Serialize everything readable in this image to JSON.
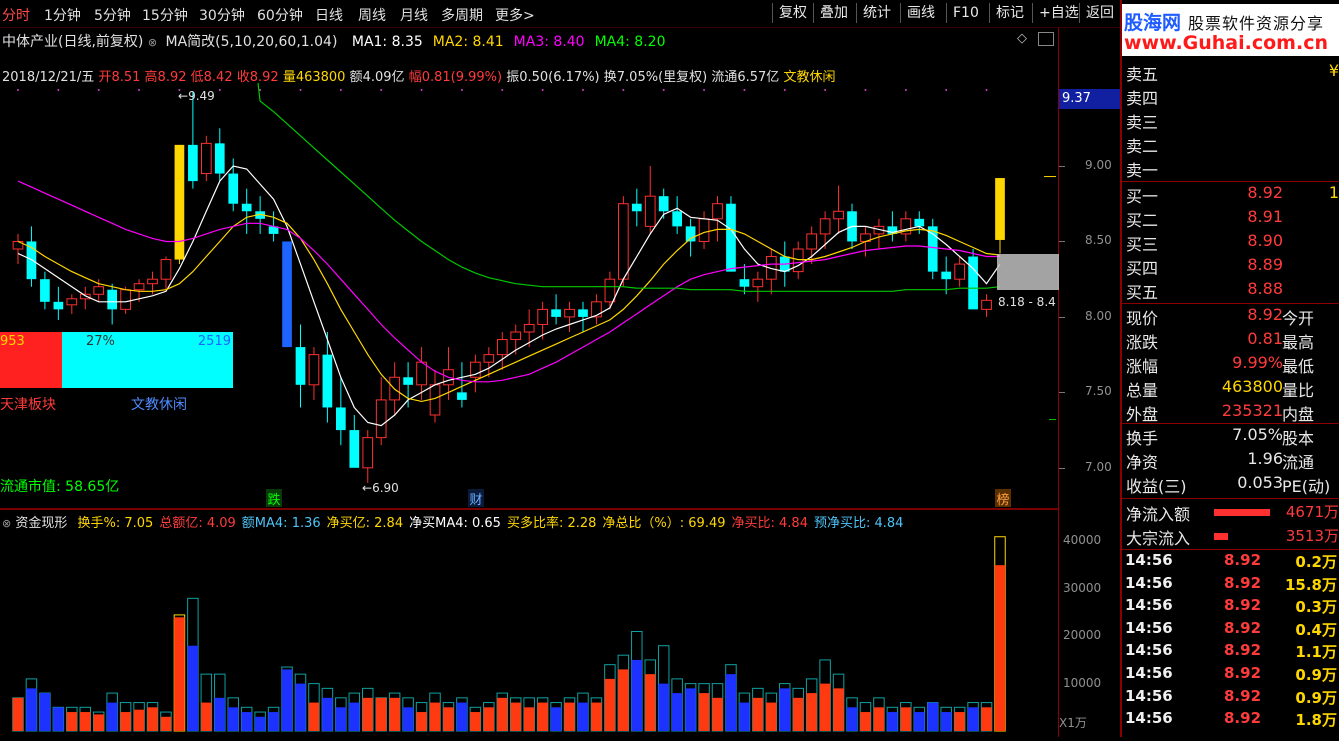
{
  "menu": {
    "periods": [
      "分时",
      "1分钟",
      "5分钟",
      "15分钟",
      "30分钟",
      "60分钟",
      "日线",
      "周线",
      "月线",
      "多周期",
      "更多>"
    ],
    "tools": [
      "复权",
      "叠加",
      "统计",
      "画线",
      "F10",
      "标记",
      "+自选",
      "返回"
    ]
  },
  "watermark": {
    "site": "股海网",
    "slogan": "股票软件资源分享",
    "url": "www.Guhai.com.cn"
  },
  "chart_header": {
    "stock": "中体产业(日线,前复权)",
    "indicator": "MA简改(5,10,20,60,1.04)",
    "ma": [
      {
        "label": "MA1: 8.35",
        "color": "#ffffff"
      },
      {
        "label": "MA2: 8.41",
        "color": "#ffd700"
      },
      {
        "label": "MA3: 8.40",
        "color": "#ff00ff"
      },
      {
        "label": "MA4: 8.20",
        "color": "#00ff00"
      }
    ]
  },
  "info_line": {
    "date": "2018/12/21/五",
    "open": "开8.51",
    "high": "高8.92",
    "low": "低8.42",
    "close": "收8.92",
    "volume": "量463800",
    "amount": "额4.09亿",
    "change": "幅0.81(9.99%)",
    "amplitude": "振0.50(6.17%)",
    "turnover": "换7.05%(里复权)",
    "float": "流通6.57亿",
    "sector": "文教休闲"
  },
  "price_axis": [
    "9.37",
    "9.00",
    "8.50",
    "8.00",
    "7.50",
    "7.00"
  ],
  "current_price_tag": "9.37",
  "annotations": {
    "high_mark": "9.49",
    "low_mark": "6.90",
    "range_label": "8.18 - 8.4",
    "fall_tag": "跌",
    "cai_tag": "财",
    "bang_tag": "榜"
  },
  "overlay": {
    "red_value": "953",
    "pct": "27%",
    "cyan_value": "2519",
    "left_label": "天津板块",
    "right_label": "文教休闲",
    "float_cap": "流通市值: 58.65亿"
  },
  "vol_header": {
    "name": "资金现形",
    "items": [
      {
        "label": "换手%: 7.05",
        "color": "#ffd700"
      },
      {
        "label": "总额亿: 4.09",
        "color": "#ff3b3b"
      },
      {
        "label": "额MA4: 1.36",
        "color": "#4fc3f7"
      },
      {
        "label": "净买亿: 2.84",
        "color": "#ffd700"
      },
      {
        "label": "净买MA4: 0.65",
        "color": "#ffffff"
      },
      {
        "label": "买多比率: 2.28",
        "color": "#ffd700"
      },
      {
        "label": "净总比（%）: 69.49",
        "color": "#ffd700"
      },
      {
        "label": "净买比: 4.84",
        "color": "#ff3b3b"
      },
      {
        "label": "预净买比: 4.84",
        "color": "#4fc3f7"
      }
    ]
  },
  "vol_axis": [
    "40000",
    "30000",
    "20000",
    "10000"
  ],
  "vol_unit": "X1万",
  "order_book": {
    "asks": [
      {
        "label": "卖五",
        "price": "",
        "vol": "¥"
      },
      {
        "label": "卖四",
        "price": "",
        "vol": ""
      },
      {
        "label": "卖三",
        "price": "",
        "vol": ""
      },
      {
        "label": "卖二",
        "price": "",
        "vol": ""
      },
      {
        "label": "卖一",
        "price": "",
        "vol": ""
      }
    ],
    "bids": [
      {
        "label": "买一",
        "price": "8.92",
        "vol": "1"
      },
      {
        "label": "买二",
        "price": "8.91",
        "vol": ""
      },
      {
        "label": "买三",
        "price": "8.90",
        "vol": ""
      },
      {
        "label": "买四",
        "price": "8.89",
        "vol": ""
      },
      {
        "label": "买五",
        "price": "8.88",
        "vol": ""
      }
    ]
  },
  "stats": [
    {
      "k": "现价",
      "v": "8.92",
      "k2": "今开"
    },
    {
      "k": "涨跌",
      "v": "0.81",
      "k2": "最高"
    },
    {
      "k": "涨幅",
      "v": "9.99%",
      "k2": "最低"
    },
    {
      "k": "总量",
      "v": "463800",
      "k2": "量比",
      "vcolor": "#ffd700"
    },
    {
      "k": "外盘",
      "v": "235321",
      "k2": "内盘"
    }
  ],
  "stats2": [
    {
      "k": "换手",
      "v": "7.05%",
      "k2": "股本"
    },
    {
      "k": "净资",
      "v": "1.96",
      "k2": "流通"
    },
    {
      "k": "收益(三)",
      "v": "0.053",
      "k2": "PE(动)"
    }
  ],
  "flow": [
    {
      "k": "净流入额",
      "v": "4671万"
    },
    {
      "k": "大宗流入",
      "v": "3513万"
    }
  ],
  "ticks": [
    {
      "t": "14:56",
      "p": "8.92",
      "a": "0.2万"
    },
    {
      "t": "14:56",
      "p": "8.92",
      "a": "15.8万"
    },
    {
      "t": "14:56",
      "p": "8.92",
      "a": "0.3万"
    },
    {
      "t": "14:56",
      "p": "8.92",
      "a": "0.4万"
    },
    {
      "t": "14:56",
      "p": "8.92",
      "a": "1.1万"
    },
    {
      "t": "14:56",
      "p": "8.92",
      "a": "0.9万"
    },
    {
      "t": "14:56",
      "p": "8.92",
      "a": "0.9万"
    },
    {
      "t": "14:56",
      "p": "8.92",
      "a": "1.8万"
    }
  ],
  "chart_data": {
    "type": "candlestick",
    "price_range": [
      6.8,
      9.55
    ],
    "candles": [
      [
        8.45,
        8.55,
        8.35,
        8.5
      ],
      [
        8.5,
        8.6,
        8.2,
        8.25
      ],
      [
        8.25,
        8.3,
        8.05,
        8.1
      ],
      [
        8.1,
        8.2,
        7.98,
        8.05
      ],
      [
        8.08,
        8.15,
        8.02,
        8.12
      ],
      [
        8.12,
        8.2,
        8.05,
        8.15
      ],
      [
        8.15,
        8.25,
        8.1,
        8.2
      ],
      [
        8.18,
        8.22,
        7.95,
        8.05
      ],
      [
        8.05,
        8.2,
        8.02,
        8.18
      ],
      [
        8.18,
        8.25,
        8.1,
        8.22
      ],
      [
        8.22,
        8.3,
        8.15,
        8.25
      ],
      [
        8.25,
        8.4,
        8.18,
        8.38
      ],
      [
        8.38,
        9.14,
        8.35,
        9.14
      ],
      [
        9.14,
        9.49,
        8.85,
        8.9
      ],
      [
        8.95,
        9.2,
        8.9,
        9.15
      ],
      [
        9.15,
        9.25,
        8.9,
        8.95
      ],
      [
        8.95,
        9.05,
        8.7,
        8.75
      ],
      [
        8.75,
        8.85,
        8.55,
        8.7
      ],
      [
        8.7,
        8.8,
        8.55,
        8.65
      ],
      [
        8.6,
        8.7,
        8.5,
        8.55
      ],
      [
        8.5,
        8.5,
        7.8,
        7.8
      ],
      [
        7.8,
        7.95,
        7.4,
        7.55
      ],
      [
        7.55,
        7.8,
        7.45,
        7.75
      ],
      [
        7.75,
        7.9,
        7.3,
        7.4
      ],
      [
        7.4,
        7.6,
        7.15,
        7.25
      ],
      [
        7.25,
        7.35,
        7.05,
        7.0
      ],
      [
        7.0,
        7.25,
        6.9,
        7.2
      ],
      [
        7.2,
        7.6,
        7.15,
        7.45
      ],
      [
        7.45,
        7.7,
        7.35,
        7.6
      ],
      [
        7.6,
        7.7,
        7.4,
        7.55
      ],
      [
        7.55,
        7.8,
        7.45,
        7.7
      ],
      [
        7.35,
        7.65,
        7.3,
        7.55
      ],
      [
        7.55,
        7.8,
        7.45,
        7.65
      ],
      [
        7.5,
        7.7,
        7.4,
        7.45
      ],
      [
        7.6,
        7.75,
        7.5,
        7.7
      ],
      [
        7.7,
        7.8,
        7.6,
        7.75
      ],
      [
        7.75,
        7.9,
        7.65,
        7.85
      ],
      [
        7.85,
        7.95,
        7.75,
        7.9
      ],
      [
        7.9,
        8.05,
        7.8,
        7.95
      ],
      [
        7.95,
        8.1,
        7.85,
        8.05
      ],
      [
        8.05,
        8.15,
        7.95,
        8.0
      ],
      [
        8.0,
        8.1,
        7.9,
        8.05
      ],
      [
        8.05,
        8.1,
        7.9,
        8.0
      ],
      [
        8.0,
        8.15,
        7.95,
        8.1
      ],
      [
        8.1,
        8.3,
        8.05,
        8.25
      ],
      [
        8.25,
        8.8,
        8.2,
        8.75
      ],
      [
        8.75,
        8.85,
        8.6,
        8.7
      ],
      [
        8.6,
        9.0,
        8.55,
        8.8
      ],
      [
        8.8,
        8.85,
        8.65,
        8.7
      ],
      [
        8.7,
        8.8,
        8.55,
        8.6
      ],
      [
        8.6,
        8.65,
        8.4,
        8.5
      ],
      [
        8.5,
        8.7,
        8.45,
        8.65
      ],
      [
        8.65,
        8.8,
        8.5,
        8.75
      ],
      [
        8.75,
        8.8,
        8.3,
        8.3
      ],
      [
        8.25,
        8.35,
        8.15,
        8.2
      ],
      [
        8.2,
        8.3,
        8.1,
        8.25
      ],
      [
        8.25,
        8.45,
        8.15,
        8.4
      ],
      [
        8.4,
        8.5,
        8.2,
        8.3
      ],
      [
        8.3,
        8.5,
        8.25,
        8.45
      ],
      [
        8.45,
        8.6,
        8.35,
        8.55
      ],
      [
        8.55,
        8.7,
        8.45,
        8.65
      ],
      [
        8.65,
        8.87,
        8.55,
        8.7
      ],
      [
        8.7,
        8.75,
        8.45,
        8.5
      ],
      [
        8.5,
        8.6,
        8.4,
        8.55
      ],
      [
        8.55,
        8.65,
        8.45,
        8.6
      ],
      [
        8.6,
        8.7,
        8.5,
        8.55
      ],
      [
        8.55,
        8.7,
        8.5,
        8.65
      ],
      [
        8.65,
        8.7,
        8.55,
        8.6
      ],
      [
        8.6,
        8.65,
        8.25,
        8.3
      ],
      [
        8.3,
        8.4,
        8.15,
        8.25
      ],
      [
        8.25,
        8.4,
        8.2,
        8.35
      ],
      [
        8.4,
        8.45,
        8.05,
        8.05
      ],
      [
        8.05,
        8.15,
        8.0,
        8.11
      ],
      [
        8.51,
        8.92,
        8.42,
        8.92
      ]
    ],
    "ma_series": {
      "MA1": [
        8.42,
        8.38,
        8.32,
        8.26,
        8.2,
        8.14,
        8.1,
        8.1,
        8.1,
        8.12,
        8.14,
        8.17,
        8.32,
        8.5,
        8.7,
        8.9,
        9.0,
        8.98,
        8.88,
        8.78,
        8.6,
        8.35,
        8.1,
        7.85,
        7.6,
        7.4,
        7.3,
        7.28,
        7.35,
        7.45,
        7.5,
        7.55,
        7.58,
        7.6,
        7.62,
        7.66,
        7.72,
        7.78,
        7.83,
        7.88,
        7.92,
        7.95,
        7.98,
        8.01,
        8.06,
        8.25,
        8.4,
        8.55,
        8.68,
        8.72,
        8.66,
        8.65,
        8.64,
        8.58,
        8.45,
        8.35,
        8.32,
        8.3,
        8.34,
        8.4,
        8.48,
        8.56,
        8.6,
        8.6,
        8.58,
        8.56,
        8.58,
        8.6,
        8.55,
        8.48,
        8.4,
        8.32,
        8.22,
        8.35
      ],
      "MA2": [
        8.5,
        8.46,
        8.4,
        8.35,
        8.3,
        8.26,
        8.22,
        8.2,
        8.18,
        8.17,
        8.17,
        8.18,
        8.22,
        8.3,
        8.4,
        8.5,
        8.6,
        8.66,
        8.68,
        8.66,
        8.62,
        8.52,
        8.38,
        8.22,
        8.05,
        7.9,
        7.75,
        7.62,
        7.52,
        7.46,
        7.44,
        7.46,
        7.5,
        7.54,
        7.58,
        7.62,
        7.66,
        7.7,
        7.74,
        7.78,
        7.82,
        7.86,
        7.9,
        7.94,
        7.98,
        8.05,
        8.14,
        8.24,
        8.35,
        8.44,
        8.52,
        8.56,
        8.58,
        8.58,
        8.55,
        8.5,
        8.45,
        8.4,
        8.38,
        8.38,
        8.4,
        8.43,
        8.46,
        8.5,
        8.53,
        8.55,
        8.57,
        8.58,
        8.57,
        8.54,
        8.5,
        8.46,
        8.42,
        8.41
      ],
      "MA3": [
        8.9,
        8.86,
        8.82,
        8.78,
        8.74,
        8.7,
        8.66,
        8.62,
        8.58,
        8.55,
        8.52,
        8.5,
        8.5,
        8.52,
        8.55,
        8.58,
        8.6,
        8.62,
        8.62,
        8.6,
        8.58,
        8.52,
        8.44,
        8.35,
        8.25,
        8.15,
        8.05,
        7.95,
        7.86,
        7.78,
        7.7,
        7.64,
        7.6,
        7.58,
        7.57,
        7.57,
        7.58,
        7.6,
        7.62,
        7.66,
        7.7,
        7.75,
        7.8,
        7.85,
        7.9,
        7.96,
        8.02,
        8.08,
        8.14,
        8.2,
        8.25,
        8.28,
        8.3,
        8.32,
        8.33,
        8.34,
        8.35,
        8.35,
        8.36,
        8.37,
        8.38,
        8.4,
        8.42,
        8.44,
        8.45,
        8.46,
        8.47,
        8.47,
        8.46,
        8.45,
        8.44,
        8.42,
        8.4,
        8.4
      ],
      "MA4": [
        null,
        null,
        null,
        null,
        null,
        null,
        null,
        null,
        null,
        null,
        null,
        null,
        null,
        null,
        null,
        null,
        null,
        null,
        9.43,
        9.36,
        9.28,
        9.2,
        9.12,
        9.04,
        8.96,
        8.88,
        8.8,
        8.72,
        8.64,
        8.57,
        8.5,
        8.44,
        8.38,
        8.33,
        8.29,
        8.26,
        8.24,
        8.22,
        8.21,
        8.2,
        8.2,
        8.2,
        8.2,
        8.2,
        8.2,
        8.2,
        8.19,
        8.19,
        8.19,
        8.19,
        8.18,
        8.18,
        8.18,
        8.18,
        8.17,
        8.17,
        8.17,
        8.17,
        8.17,
        8.17,
        8.17,
        8.17,
        8.17,
        8.17,
        8.17,
        8.17,
        8.18,
        8.18,
        8.18,
        8.18,
        8.19,
        8.19,
        8.19,
        8.2
      ]
    },
    "volume_range": [
      0,
      42000
    ],
    "volumes": [
      {
        "b": 7000,
        "o": 7000
      },
      {
        "b": 9000,
        "o": 11000
      },
      {
        "b": 8000,
        "o": 8000
      },
      {
        "b": 5000,
        "o": 5000
      },
      {
        "b": 4000,
        "o": 5000
      },
      {
        "b": 4000,
        "o": 5000
      },
      {
        "b": 3500,
        "o": 4000
      },
      {
        "b": 6000,
        "o": 8000
      },
      {
        "b": 4000,
        "o": 6000
      },
      {
        "b": 4500,
        "o": 6000
      },
      {
        "b": 5000,
        "o": 6000
      },
      {
        "b": 3000,
        "o": 4000
      },
      {
        "b": 24000,
        "o": 24500
      },
      {
        "b": 18000,
        "o": 28000
      },
      {
        "b": 6000,
        "o": 12000
      },
      {
        "b": 7000,
        "o": 12000
      },
      {
        "b": 5000,
        "o": 7000
      },
      {
        "b": 4000,
        "o": 5000
      },
      {
        "b": 3000,
        "o": 4000
      },
      {
        "b": 4000,
        "o": 5000
      },
      {
        "b": 13000,
        "o": 13500
      },
      {
        "b": 10000,
        "o": 12000
      },
      {
        "b": 6000,
        "o": 10000
      },
      {
        "b": 7000,
        "o": 9000
      },
      {
        "b": 5000,
        "o": 7000
      },
      {
        "b": 6000,
        "o": 8000
      },
      {
        "b": 7000,
        "o": 9000
      },
      {
        "b": 7000,
        "o": 7000
      },
      {
        "b": 7000,
        "o": 8000
      },
      {
        "b": 5000,
        "o": 7000
      },
      {
        "b": 4000,
        "o": 6000
      },
      {
        "b": 6000,
        "o": 8000
      },
      {
        "b": 5000,
        "o": 6000
      },
      {
        "b": 6000,
        "o": 7000
      },
      {
        "b": 4000,
        "o": 5000
      },
      {
        "b": 5000,
        "o": 6000
      },
      {
        "b": 7000,
        "o": 8000
      },
      {
        "b": 6000,
        "o": 7000
      },
      {
        "b": 5000,
        "o": 7000
      },
      {
        "b": 6000,
        "o": 7000
      },
      {
        "b": 5000,
        "o": 6000
      },
      {
        "b": 6000,
        "o": 7000
      },
      {
        "b": 6000,
        "o": 8000
      },
      {
        "b": 6000,
        "o": 7000
      },
      {
        "b": 11000,
        "o": 14000
      },
      {
        "b": 13000,
        "o": 16000
      },
      {
        "b": 15000,
        "o": 21000
      },
      {
        "b": 12000,
        "o": 15000
      },
      {
        "b": 10000,
        "o": 18000
      },
      {
        "b": 8000,
        "o": 11000
      },
      {
        "b": 9000,
        "o": 10000
      },
      {
        "b": 8000,
        "o": 10000
      },
      {
        "b": 7000,
        "o": 10000
      },
      {
        "b": 12000,
        "o": 14000
      },
      {
        "b": 6000,
        "o": 8000
      },
      {
        "b": 7000,
        "o": 9000
      },
      {
        "b": 6000,
        "o": 8000
      },
      {
        "b": 9000,
        "o": 10000
      },
      {
        "b": 7000,
        "o": 9000
      },
      {
        "b": 8000,
        "o": 11000
      },
      {
        "b": 10000,
        "o": 15000
      },
      {
        "b": 9000,
        "o": 12000
      },
      {
        "b": 5000,
        "o": 7000
      },
      {
        "b": 4000,
        "o": 6000
      },
      {
        "b": 5000,
        "o": 7000
      },
      {
        "b": 4000,
        "o": 5000
      },
      {
        "b": 5000,
        "o": 6000
      },
      {
        "b": 4000,
        "o": 5000
      },
      {
        "b": 6000,
        "o": 6000
      },
      {
        "b": 4000,
        "o": 5000
      },
      {
        "b": 4000,
        "o": 5000
      },
      {
        "b": 5000,
        "o": 6000
      },
      {
        "b": 5000,
        "o": 6000
      },
      {
        "b": 35000,
        "o": 41000
      }
    ]
  }
}
